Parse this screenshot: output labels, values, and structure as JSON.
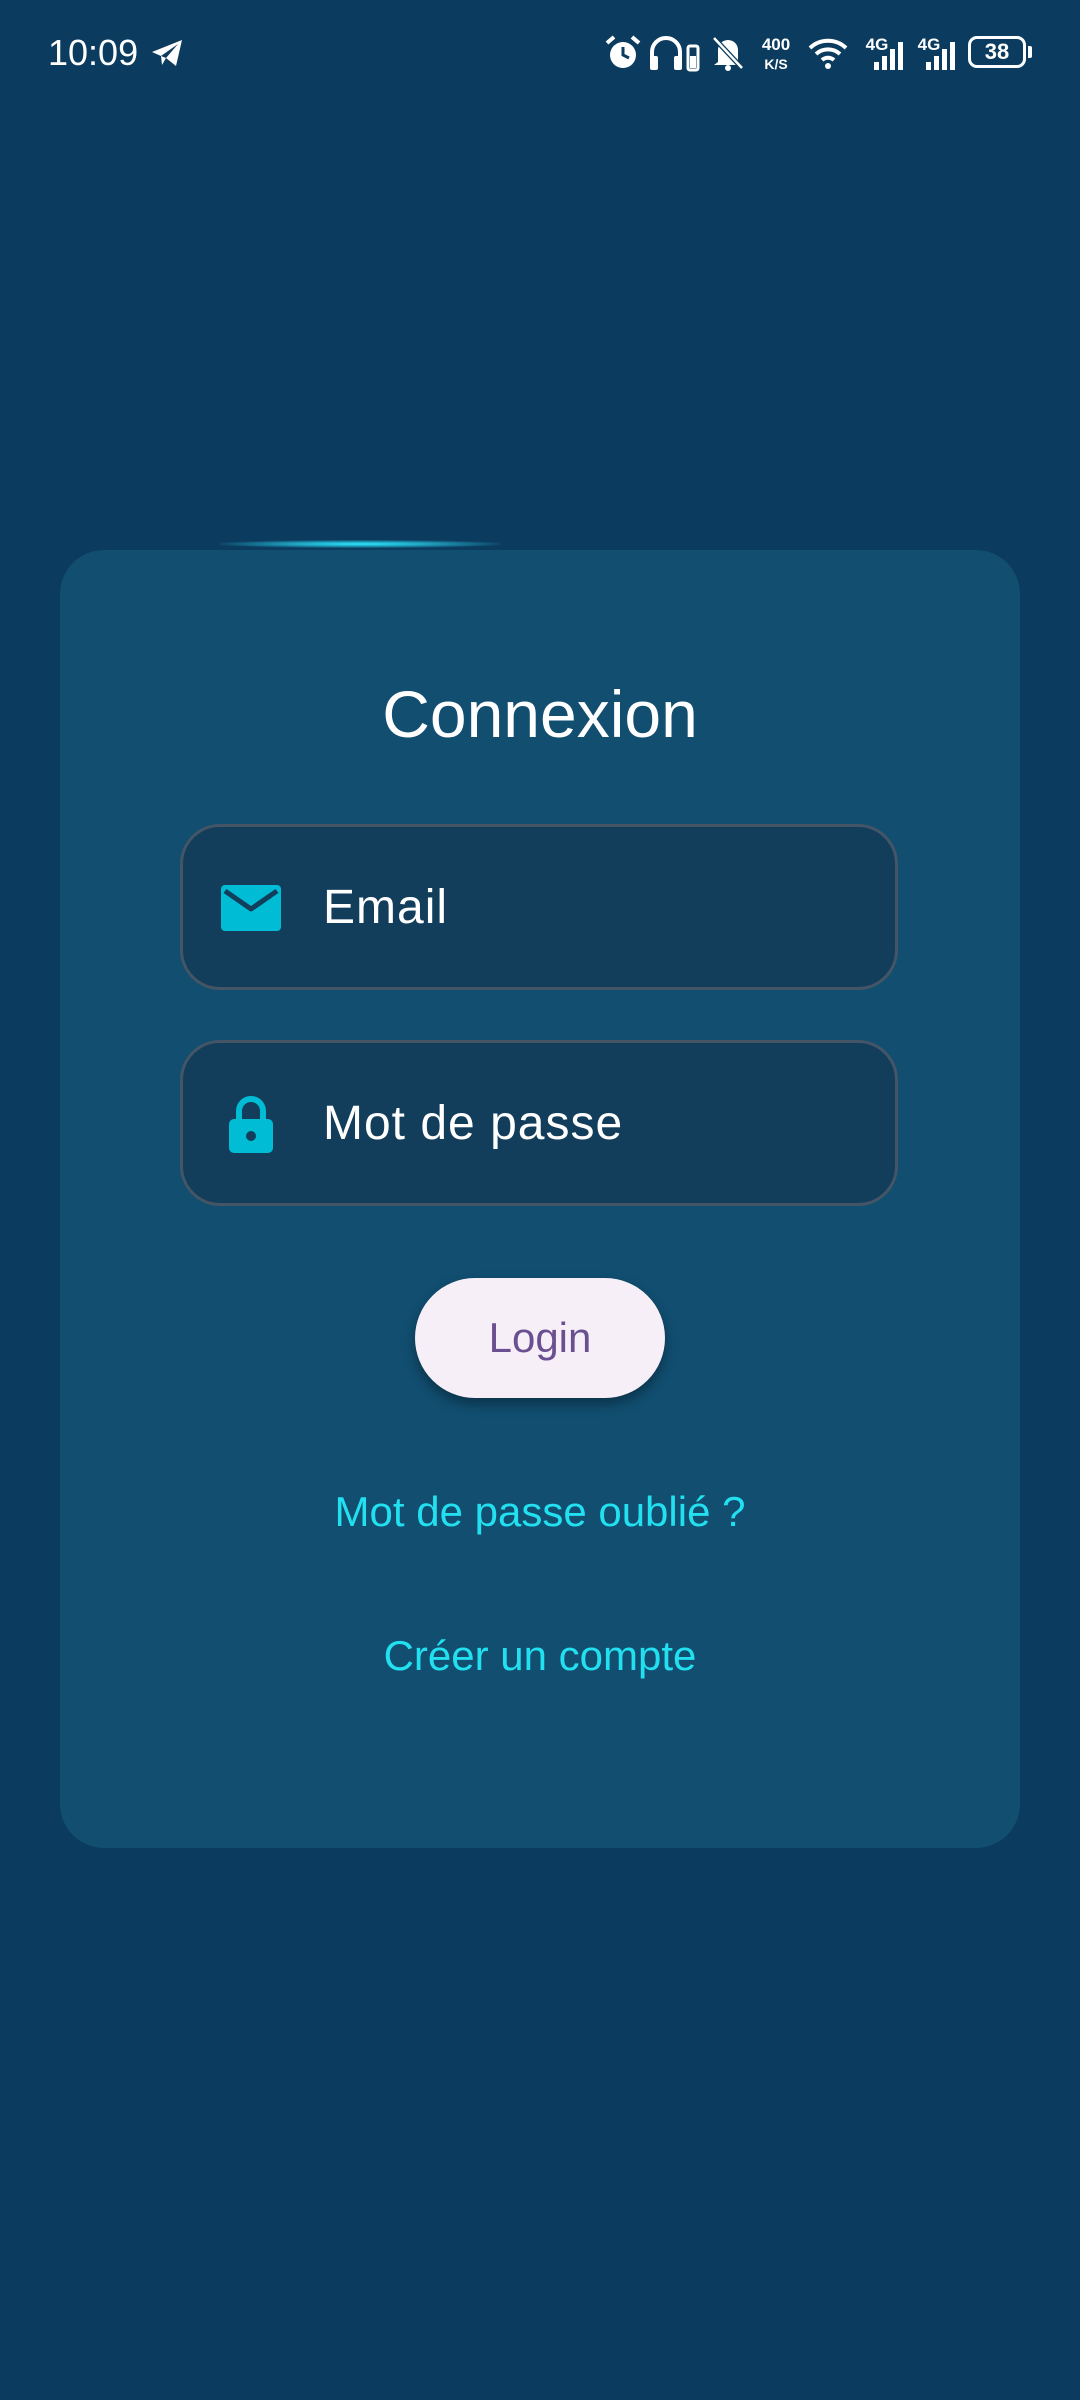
{
  "status_bar": {
    "time": "10:09",
    "network_speed_value": "400",
    "network_speed_unit": "K/S",
    "signal_1_label": "4G",
    "signal_2_label": "4G",
    "battery_level": "38",
    "icons": [
      "telegram-icon",
      "alarm-icon",
      "headphones-icon",
      "bell-off-icon",
      "wifi-icon",
      "signal-icon",
      "battery-icon"
    ]
  },
  "login": {
    "title": "Connexion",
    "email_placeholder": "Email",
    "password_placeholder": "Mot de passe",
    "login_label": "Login",
    "forgot_password_label": "Mot de passe oublié ?",
    "create_account_label": "Créer un compte"
  },
  "colors": {
    "background": "#0b3c5f",
    "card": "#114e70",
    "field": "#123e5c",
    "icon_accent": "#00bcd4",
    "link": "#22e0f0",
    "button_bg": "#f7eff7",
    "button_text": "#6a5090"
  }
}
